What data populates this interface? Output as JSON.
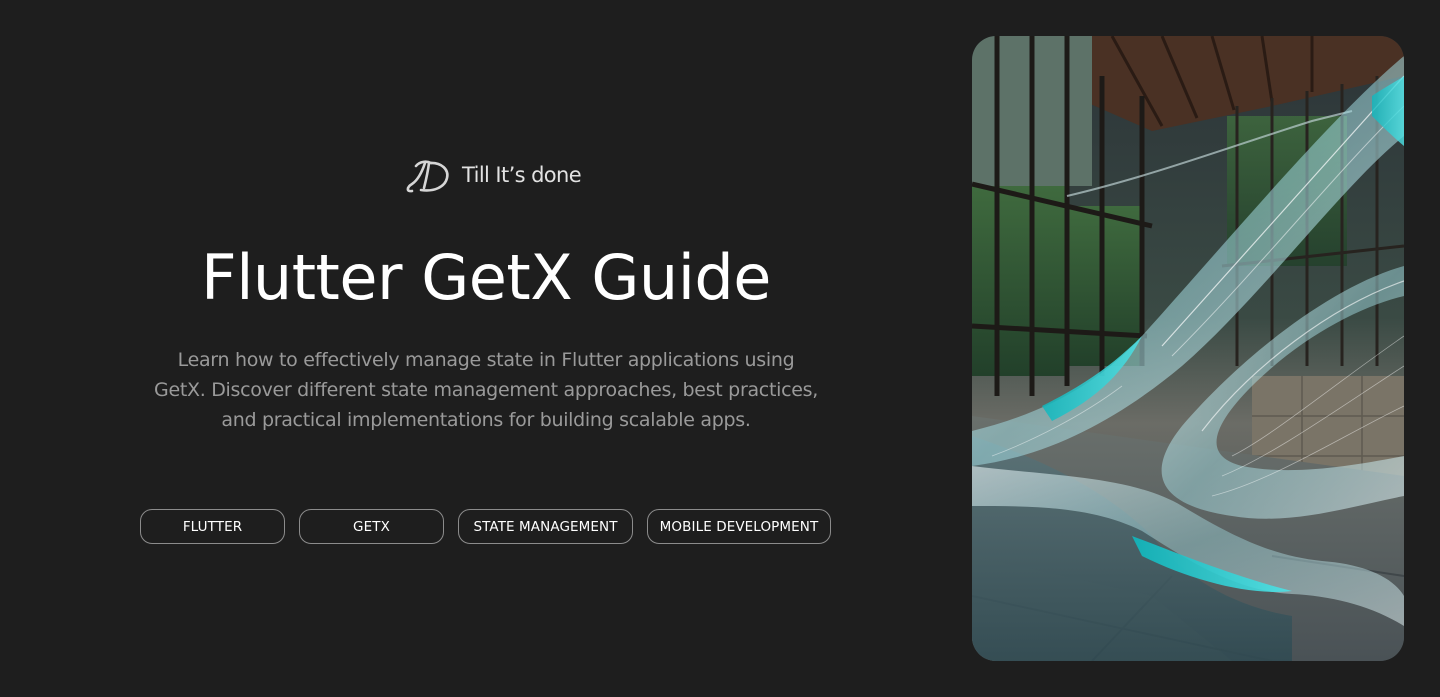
{
  "brand": {
    "name": "Till It’s done",
    "logo_icon": "td-monogram-icon"
  },
  "hero": {
    "title": "Flutter GetX Guide",
    "description": "Learn how to effectively manage state in Flutter applications using GetX. Discover different state management approaches, best practices, and practical implementations for building scalable apps."
  },
  "tags": [
    {
      "label": "FLUTTER"
    },
    {
      "label": "GETX"
    },
    {
      "label": "STATE MANAGEMENT"
    },
    {
      "label": "MOBILE DEVELOPMENT"
    }
  ],
  "colors": {
    "background": "#1e1e1e",
    "title_text": "#ffffff",
    "description_text": "#9a9a9a",
    "tag_border": "#8c8c8c",
    "image_accent": "#17c4c8"
  },
  "hero_image": {
    "subject": "abstract-glass-ribbon-sculpture-in-atrium"
  }
}
